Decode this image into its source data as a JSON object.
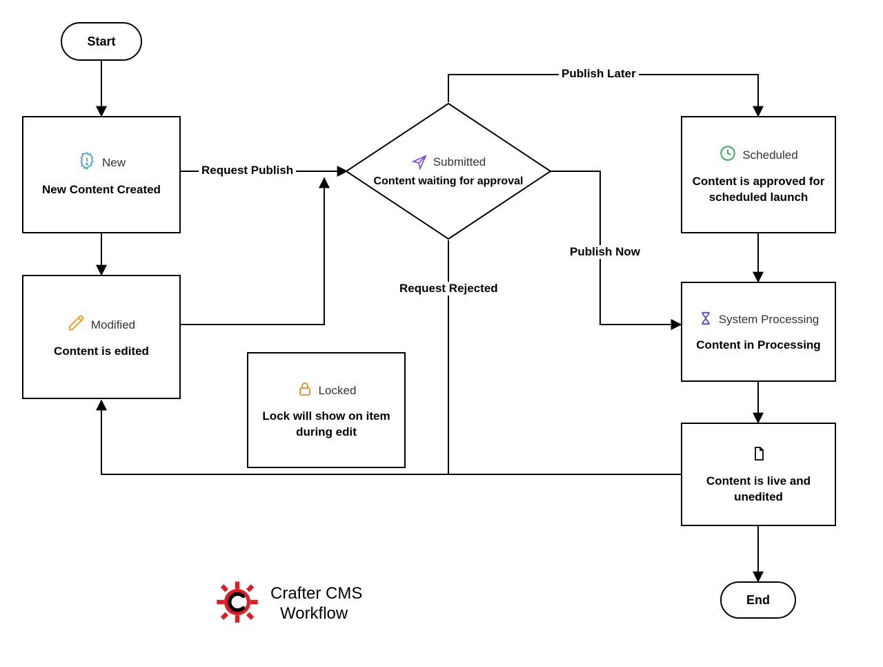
{
  "terminators": {
    "start": "Start",
    "end": "End"
  },
  "nodes": {
    "new": {
      "icon_label": "New",
      "caption": "New Content Created"
    },
    "modified": {
      "icon_label": "Modified",
      "caption": "Content is edited"
    },
    "locked": {
      "icon_label": "Locked",
      "caption": "Lock will show on item during edit"
    },
    "submitted": {
      "icon_label": "Submitted",
      "caption": "Content waiting for approval"
    },
    "scheduled": {
      "icon_label": "Scheduled",
      "caption": "Content is approved for scheduled launch"
    },
    "processing": {
      "icon_label": "System Processing",
      "caption": "Content in Processing"
    },
    "live": {
      "caption": "Content is live and unedited"
    }
  },
  "edges": {
    "request_publish": "Request Publish",
    "publish_later": "Publish Later",
    "publish_now": "Publish Now",
    "request_rejected": "Request Rejected"
  },
  "branding": {
    "line1": "Crafter CMS",
    "line2": "Workflow"
  },
  "colors": {
    "new_icon": "#4aa8d8",
    "modified_icon": "#f0a020",
    "locked_icon": "#e58a1e",
    "submitted_icon": "#7b3fe4",
    "scheduled_icon": "#2eaf4d",
    "processing_icon": "#3b3fd8",
    "brand_red": "#e31b23"
  }
}
